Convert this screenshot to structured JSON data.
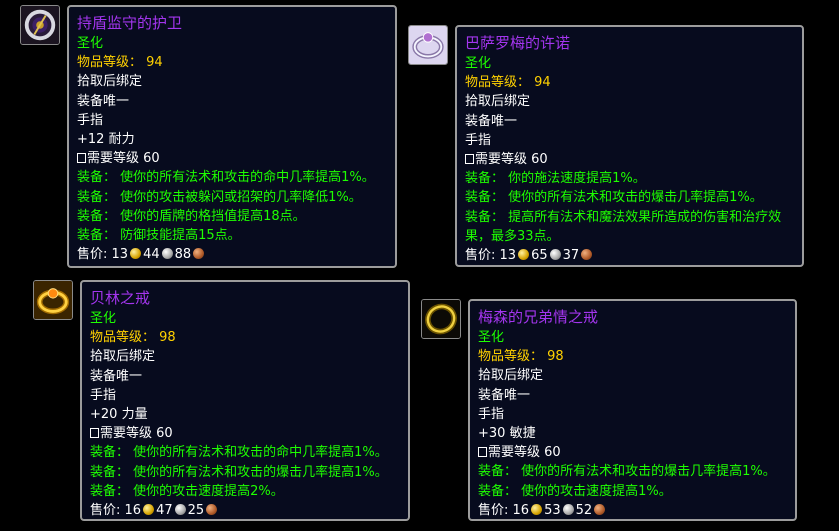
{
  "items": [
    {
      "title": "持盾监守的护卫",
      "heroic": "圣化",
      "ilvl_label": "物品等级：",
      "ilvl": "94",
      "bind": "拾取后绑定",
      "unique": "装备唯一",
      "slot": "手指",
      "stat": "+12 耐力",
      "req": "需要等级 60",
      "equips": [
        "装备： 使你的所有法术和攻击的命中几率提高1%。",
        "装备： 使你的攻击被躲闪或招架的几率降低1%。",
        "装备： 使你的盾牌的格挡值提高18点。",
        "装备： 防御技能提高15点。"
      ],
      "price_label": "售价:",
      "gold": "13",
      "silver": "44",
      "copper": "88",
      "icon": "ring-purple-icon"
    },
    {
      "title": "巴萨罗梅的许诺",
      "heroic": "圣化",
      "ilvl_label": "物品等级：",
      "ilvl": "94",
      "bind": "拾取后绑定",
      "unique": "装备唯一",
      "slot": "手指",
      "req": "需要等级 60",
      "equips": [
        "装备： 你的施法速度提高1%。",
        "装备： 使你的所有法术和攻击的爆击几率提高1%。",
        "装备： 提高所有法术和魔法效果所造成的伤害和治疗效果，最多33点。"
      ],
      "price_label": "售价:",
      "gold": "13",
      "silver": "65",
      "copper": "37",
      "icon": "ring-silver-icon"
    },
    {
      "title": "贝林之戒",
      "heroic": "圣化",
      "ilvl_label": "物品等级：",
      "ilvl": "98",
      "bind": "拾取后绑定",
      "unique": "装备唯一",
      "slot": "手指",
      "stat": "+20 力量",
      "req": "需要等级 60",
      "equips": [
        "装备： 使你的所有法术和攻击的命中几率提高1%。",
        "装备： 使你的所有法术和攻击的爆击几率提高1%。",
        "装备： 使你的攻击速度提高2%。"
      ],
      "price_label": "售价:",
      "gold": "16",
      "silver": "47",
      "copper": "25",
      "icon": "ring-gold-icon"
    },
    {
      "title": "梅森的兄弟情之戒",
      "heroic": "圣化",
      "ilvl_label": "物品等级：",
      "ilvl": "98",
      "bind": "拾取后绑定",
      "unique": "装备唯一",
      "slot": "手指",
      "stat": "+30 敏捷",
      "req": "需要等级 60",
      "equips": [
        "装备： 使你的所有法术和攻击的爆击几率提高1%。",
        "装备： 使你的攻击速度提高1%。"
      ],
      "price_label": "售价:",
      "gold": "16",
      "silver": "53",
      "copper": "52",
      "icon": "ring-dark-gold-icon"
    }
  ]
}
